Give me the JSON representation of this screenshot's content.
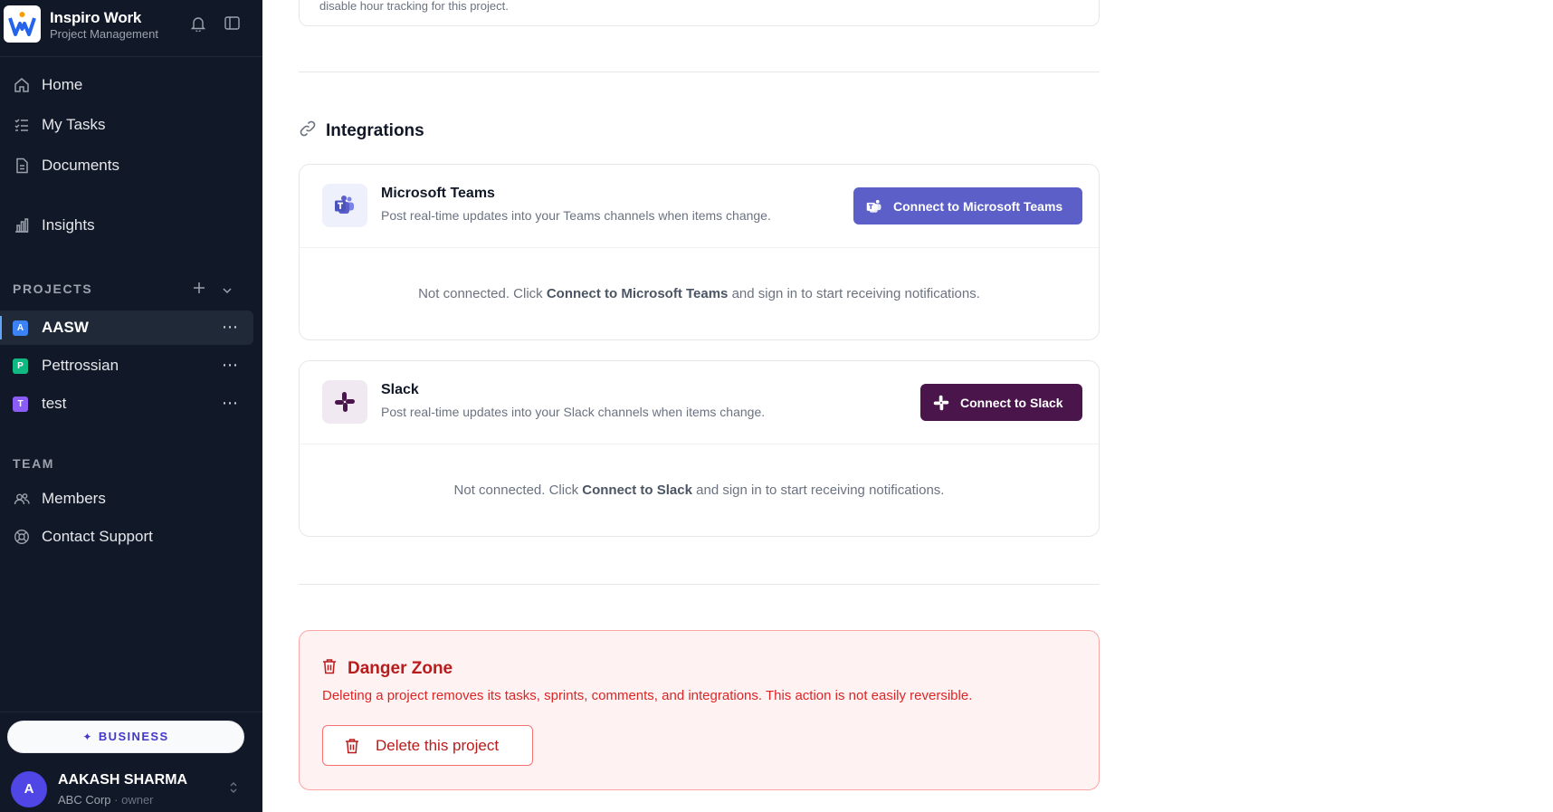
{
  "brand": {
    "title": "Inspiro Work",
    "subtitle": "Project Management"
  },
  "nav": [
    {
      "label": "Home",
      "icon": "home-icon"
    },
    {
      "label": "My Tasks",
      "icon": "tasks-icon"
    },
    {
      "label": "Documents",
      "icon": "document-icon"
    },
    {
      "label": "Insights",
      "icon": "chart-icon"
    }
  ],
  "projects": {
    "label": "PROJECTS",
    "items": [
      {
        "initial": "A",
        "name": "AASW",
        "color": "#3b82f6",
        "active": true
      },
      {
        "initial": "P",
        "name": "Pettrossian",
        "color": "#10b981",
        "active": false
      },
      {
        "initial": "T",
        "name": "test",
        "color": "#8b5cf6",
        "active": false
      }
    ],
    "more": "⋯"
  },
  "team": {
    "label": "TEAM",
    "items": [
      {
        "label": "Members",
        "icon": "members-icon"
      },
      {
        "label": "Contact Support",
        "icon": "support-icon"
      }
    ]
  },
  "plan": {
    "label": "BUSINESS"
  },
  "user": {
    "initial": "A",
    "name": "AAKASH SHARMA",
    "org": "ABC Corp",
    "separator": " · ",
    "role": "owner"
  },
  "main": {
    "top_card_text": "disable hour tracking for this project.",
    "integrations": {
      "title": "Integrations",
      "items": [
        {
          "name": "Microsoft Teams",
          "description": "Post real-time updates into your Teams channels when items change.",
          "button": "Connect to Microsoft Teams",
          "status_pre": "Not connected. Click ",
          "status_bold": "Connect to Microsoft Teams",
          "status_post": " and sign in to start receiving notifications.",
          "accent": "#5b5fc7"
        },
        {
          "name": "Slack",
          "description": "Post real-time updates into your Slack channels when items change.",
          "button": "Connect to Slack",
          "status_pre": "Not connected. Click ",
          "status_bold": "Connect to Slack",
          "status_post": " and sign in to start receiving notifications.",
          "accent": "#4a154b"
        }
      ]
    },
    "danger": {
      "title": "Danger Zone",
      "description": "Deleting a project removes its tasks, sprints, comments, and integrations. This action is not easily reversible.",
      "button": "Delete this project"
    }
  },
  "colors": {
    "sidebar": "#111827",
    "danger": "#b91c1c",
    "teams": "#5b5fc7",
    "slack": "#4a154b"
  }
}
